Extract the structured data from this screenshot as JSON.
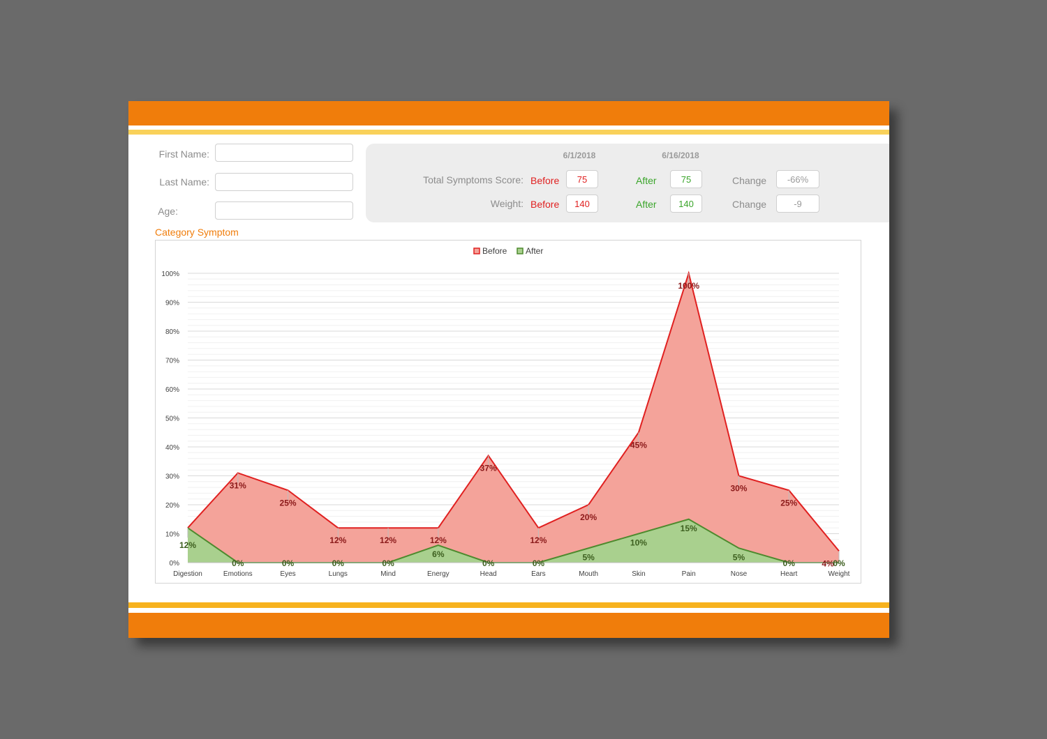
{
  "form": {
    "first_name_label": "First Name:",
    "last_name_label": "Last Name:",
    "age_label": "Age:",
    "first_name_value": "",
    "last_name_value": "",
    "age_value": ""
  },
  "summary": {
    "date_before": "6/1/2018",
    "date_after": "6/16/2018",
    "score_label": "Total Symptoms Score:",
    "weight_label": "Weight:",
    "before_label": "Before",
    "after_label": "After",
    "change_label": "Change",
    "score_before": "75",
    "score_after": "75",
    "score_change": "-66%",
    "weight_before": "140",
    "weight_after": "140",
    "weight_change": "-9"
  },
  "section_title": "Category Symptom",
  "colors": {
    "orange": "#f07d0b",
    "yellow": "#f9d15a",
    "before_line": "#e02020",
    "before_fill": "#f4a39a",
    "after_line": "#4e8a2e",
    "after_fill": "#a9d08e"
  },
  "chart_data": {
    "type": "area",
    "categories": [
      "Digestion",
      "Emotions",
      "Eyes",
      "Lungs",
      "Mind",
      "Energy",
      "Head",
      "Ears",
      "Mouth",
      "Skin",
      "Pain",
      "Nose",
      "Heart",
      "Weight"
    ],
    "series": [
      {
        "name": "Before",
        "values": [
          12,
          31,
          25,
          12,
          12,
          12,
          37,
          12,
          20,
          45,
          100,
          30,
          25,
          4
        ]
      },
      {
        "name": "After",
        "values": [
          12,
          0,
          0,
          0,
          0,
          6,
          0,
          0,
          5,
          10,
          15,
          5,
          0,
          0
        ]
      }
    ],
    "data_labels": {
      "Before": [
        "",
        "31%",
        "25%",
        "12%",
        "12%",
        "12%",
        "37%",
        "12%",
        "20%",
        "45%",
        "100%",
        "30%",
        "25%",
        "4%"
      ],
      "After": [
        "12%",
        "0%",
        "0%",
        "0%",
        "0%",
        "6%",
        "0%",
        "0%",
        "5%",
        "10%",
        "15%",
        "5%",
        "0%",
        "0%"
      ]
    },
    "y_ticks": [
      "0%",
      "10%",
      "20%",
      "30%",
      "40%",
      "50%",
      "60%",
      "70%",
      "80%",
      "90%",
      "100%"
    ],
    "ylim": [
      0,
      100
    ],
    "legend": "top",
    "grid": true
  }
}
